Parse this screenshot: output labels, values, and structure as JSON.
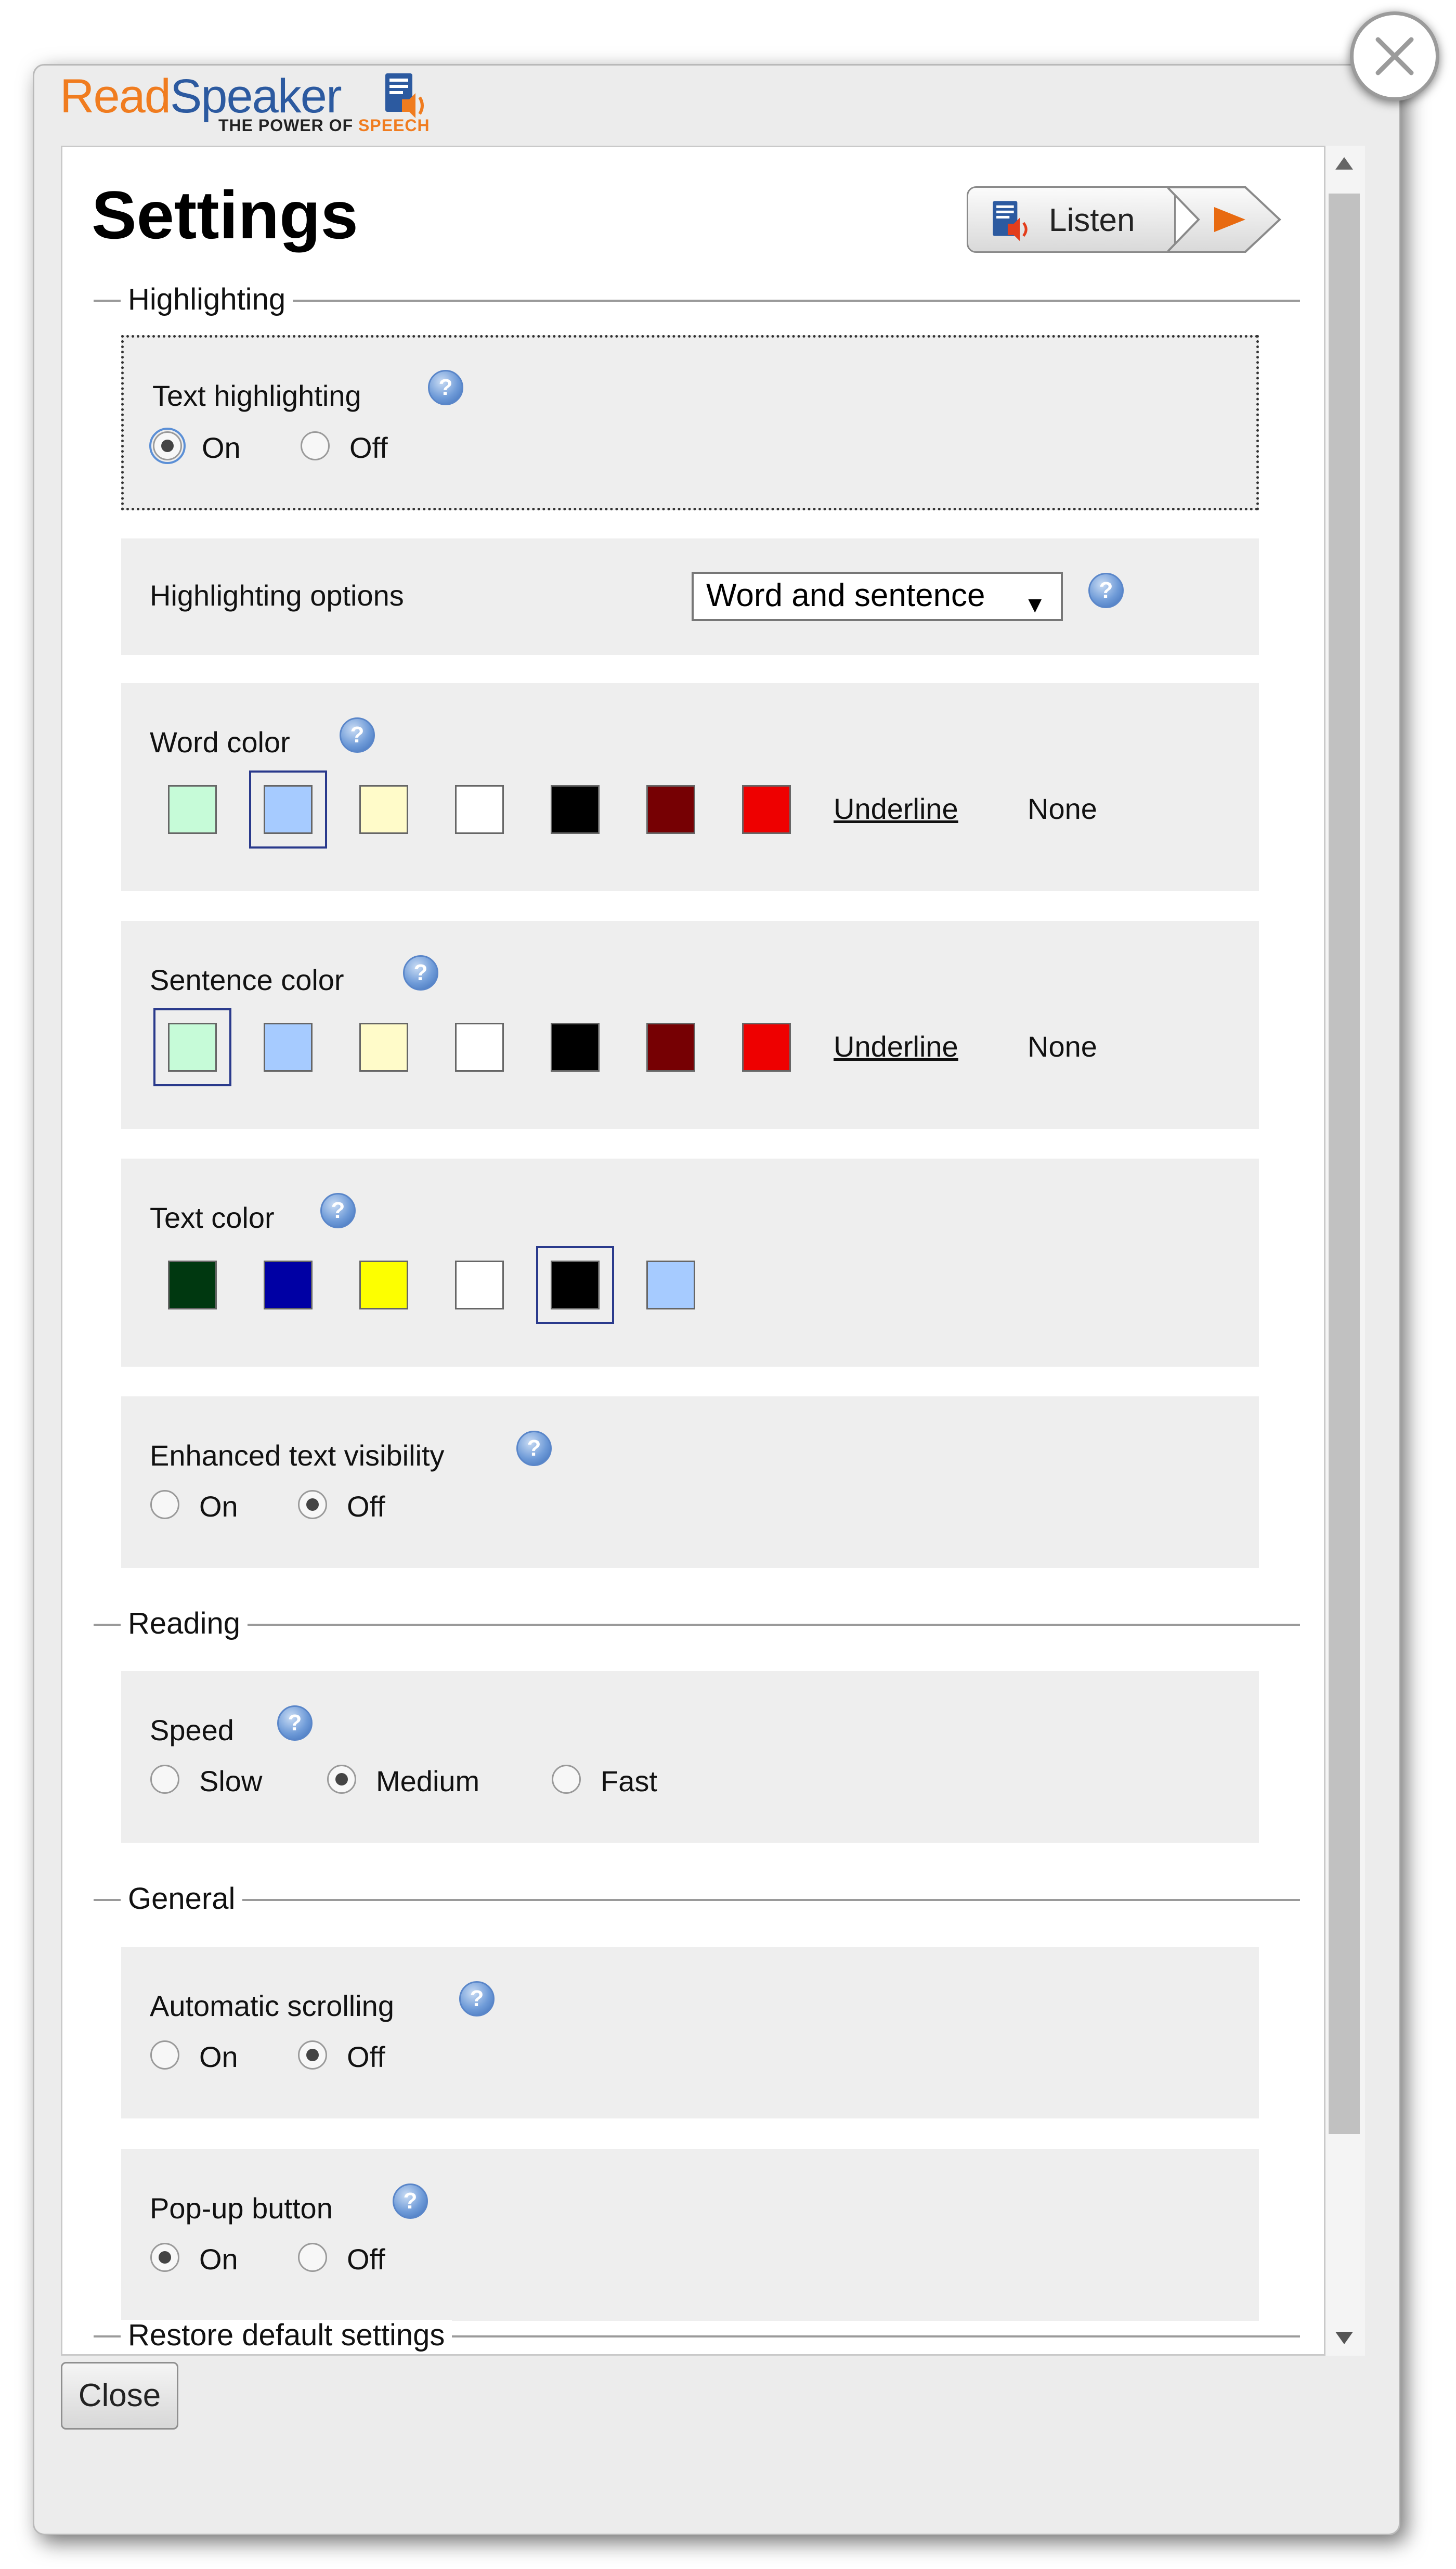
{
  "logo": {
    "part1": "Read",
    "part2": "Speaker",
    "tagline_a": "THE POWER OF ",
    "tagline_b": "SPEECH"
  },
  "page_title": "Settings",
  "listen_label": "Listen",
  "sections": {
    "highlighting": "Highlighting",
    "reading": "Reading",
    "general": "General",
    "restore": "Restore default settings"
  },
  "text_highlighting": {
    "label": "Text highlighting",
    "on": "On",
    "off": "Off",
    "selected": "On"
  },
  "highlighting_options": {
    "label": "Highlighting options",
    "value": "Word and sentence"
  },
  "word_color": {
    "label": "Word color",
    "underline": "Underline",
    "none": "None",
    "selected_index": 1
  },
  "sentence_color": {
    "label": "Sentence color",
    "underline": "Underline",
    "none": "None",
    "selected_index": 0
  },
  "text_color": {
    "label": "Text color",
    "selected_index": 4
  },
  "enhanced_visibility": {
    "label": "Enhanced text visibility",
    "on": "On",
    "off": "Off",
    "selected": "Off"
  },
  "speed": {
    "label": "Speed",
    "slow": "Slow",
    "medium": "Medium",
    "fast": "Fast",
    "selected": "Medium"
  },
  "auto_scroll": {
    "label": "Automatic scrolling",
    "on": "On",
    "off": "Off",
    "selected": "Off"
  },
  "popup_button": {
    "label": "Pop-up button",
    "on": "On",
    "off": "Off",
    "selected": "On"
  },
  "close_label": "Close",
  "colors": {
    "highlight_swatches": [
      "#c6fbd8",
      "#a6cbff",
      "#fffbc9",
      "#ffffff",
      "#000000",
      "#760003",
      "#ee0000"
    ],
    "text_swatches": [
      "#003810",
      "#0000a4",
      "#fdff00",
      "#ffffff",
      "#000000",
      "#a6cbff"
    ],
    "orange": "#f07c1f",
    "blue": "#2c5aa0"
  }
}
